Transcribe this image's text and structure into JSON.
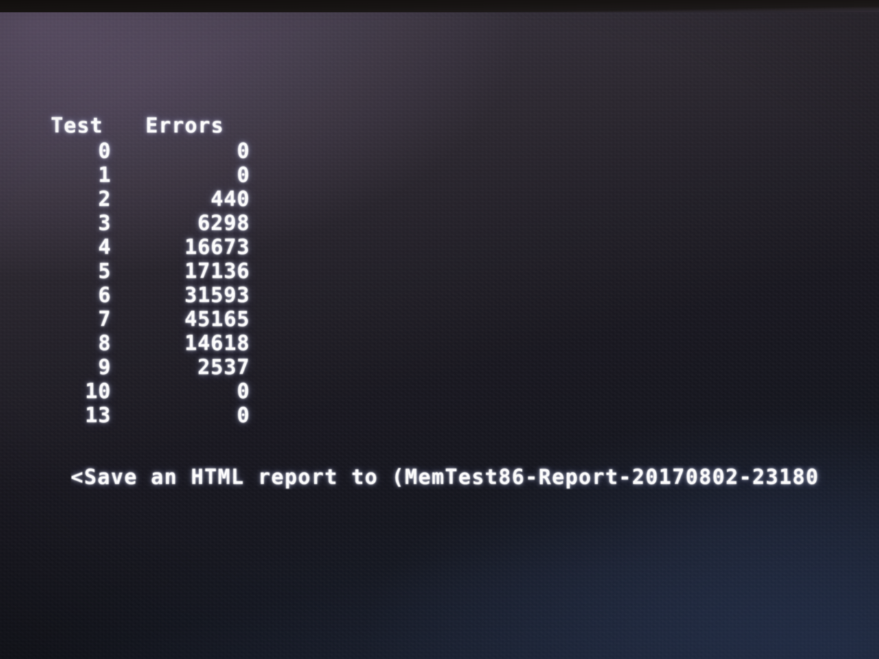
{
  "screen": {
    "program": "MemTest86",
    "background_color": "#1a1922",
    "text_color": "#ffffff",
    "bezel_color": "#141111",
    "room_light_color": "#a8761f",
    "glow_color": "#c8d2ff"
  },
  "results": {
    "columns": [
      "Test",
      "Errors"
    ],
    "rows": [
      {
        "test": "0",
        "errors": "0"
      },
      {
        "test": "1",
        "errors": "0"
      },
      {
        "test": "2",
        "errors": "440"
      },
      {
        "test": "3",
        "errors": "6298"
      },
      {
        "test": "4",
        "errors": "16673"
      },
      {
        "test": "5",
        "errors": "17136"
      },
      {
        "test": "6",
        "errors": "31593"
      },
      {
        "test": "7",
        "errors": "45165"
      },
      {
        "test": "8",
        "errors": "14618"
      },
      {
        "test": "9",
        "errors": "2537"
      },
      {
        "test": "10",
        "errors": "0"
      },
      {
        "test": "13",
        "errors": "0"
      }
    ]
  },
  "prompt": {
    "text": "<Save an HTML report to (MemTest86-Report-20170802-23180",
    "full_text_hint": "<Save an HTML report to (MemTest86-Report-20170802-23180",
    "truncated": "true"
  }
}
